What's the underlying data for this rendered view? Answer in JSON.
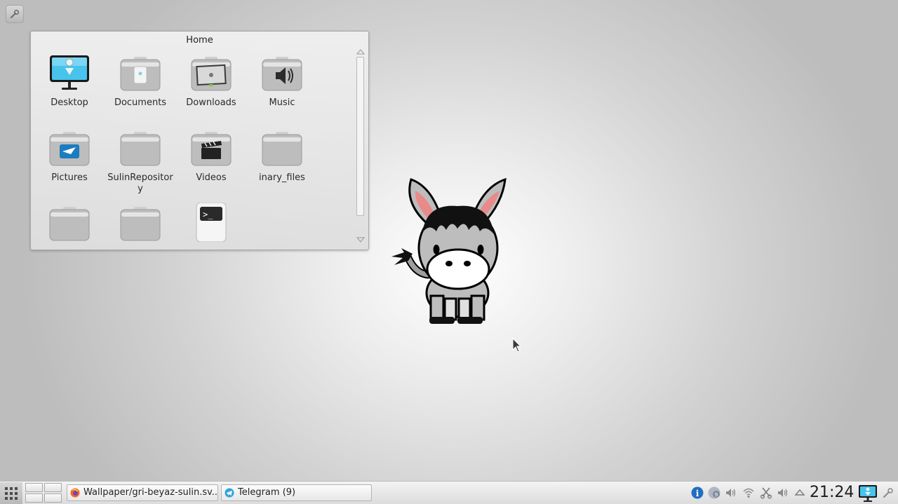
{
  "desktop": {
    "folderview": {
      "title": "Home",
      "items": [
        {
          "label": "Desktop",
          "icon": "desktop-monitor-icon"
        },
        {
          "label": "Documents",
          "icon": "documents-folder-icon"
        },
        {
          "label": "Downloads",
          "icon": "downloads-folder-icon"
        },
        {
          "label": "Music",
          "icon": "music-folder-icon"
        },
        {
          "label": "Pictures",
          "icon": "pictures-folder-icon"
        },
        {
          "label": "SulinRepository",
          "icon": "folder-icon"
        },
        {
          "label": "Videos",
          "icon": "videos-folder-icon"
        },
        {
          "label": "inary_files",
          "icon": "folder-icon"
        },
        {
          "label": "",
          "icon": "folder-icon"
        },
        {
          "label": "",
          "icon": "folder-icon"
        },
        {
          "label": "",
          "icon": "terminal-script-icon"
        }
      ]
    },
    "wallpaper": {
      "image": "donkey-mascot",
      "colors": {
        "background": "#d6d6d6",
        "center": "#ffffff"
      }
    }
  },
  "taskbar": {
    "launcher_icon": "app-grid-icon",
    "pager_desktops": 4,
    "tasks": [
      {
        "label": "Wallpaper/gri-beyaz-sulin.sv...",
        "icon": "firefox-icon"
      },
      {
        "label": "Telegram (9)",
        "icon": "telegram-icon"
      }
    ],
    "tray": [
      {
        "icon": "info-icon",
        "color": "#1f6fc2"
      },
      {
        "icon": "updates-badge-icon",
        "color": "#5b8ec4"
      },
      {
        "icon": "volume-icon"
      },
      {
        "icon": "wifi-icon"
      },
      {
        "icon": "scissors-icon"
      },
      {
        "icon": "volume-icon"
      },
      {
        "icon": "expand-up-icon"
      }
    ],
    "clock": "21:24",
    "show_desktop_icon": "show-desktop-icon",
    "panel_tool_icon": "wrench-icon"
  }
}
